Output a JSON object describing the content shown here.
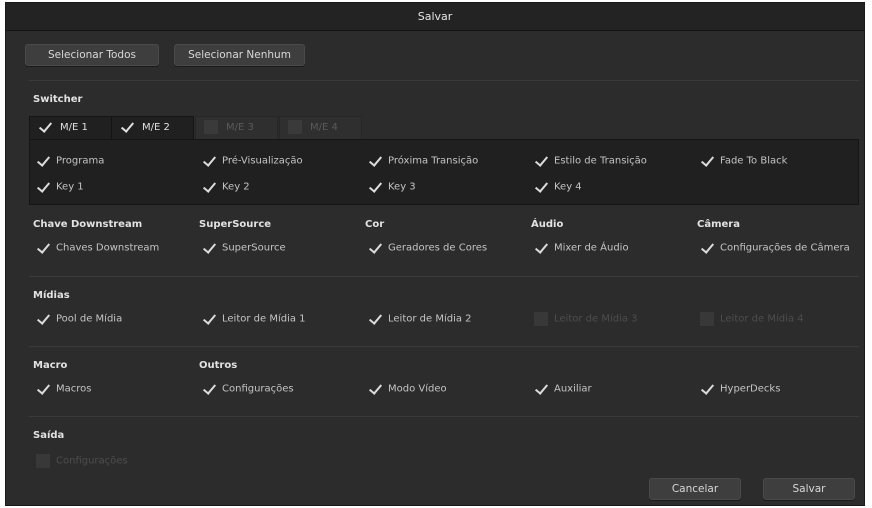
{
  "dialog": {
    "title": "Salvar"
  },
  "top_buttons": {
    "select_all": "Selecionar Todos",
    "select_none": "Selecionar Nenhum"
  },
  "switcher": {
    "title": "Switcher",
    "tabs": [
      {
        "label": "M/E 1",
        "checked": true,
        "active": true
      },
      {
        "label": "M/E 2",
        "checked": true,
        "active": true
      },
      {
        "label": "M/E 3",
        "checked": false,
        "active": false
      },
      {
        "label": "M/E 4",
        "checked": false,
        "active": false
      }
    ],
    "items": [
      {
        "label": "Programa",
        "checked": true
      },
      {
        "label": "Pré-Visualização",
        "checked": true
      },
      {
        "label": "Próxima Transição",
        "checked": true
      },
      {
        "label": "Estilo de Transição",
        "checked": true
      },
      {
        "label": "Fade To Black",
        "checked": true
      },
      {
        "label": "Key 1",
        "checked": true
      },
      {
        "label": "Key 2",
        "checked": true
      },
      {
        "label": "Key 3",
        "checked": true
      },
      {
        "label": "Key 4",
        "checked": true
      }
    ]
  },
  "groups_row": [
    {
      "title": "Chave Downstream",
      "item": "Chaves Downstream"
    },
    {
      "title": "SuperSource",
      "item": "SuperSource"
    },
    {
      "title": "Cor",
      "item": "Geradores de Cores"
    },
    {
      "title": "Áudio",
      "item": "Mixer de Áudio"
    },
    {
      "title": "Câmera",
      "item": "Configurações de Câmera"
    }
  ],
  "midias": {
    "title": "Mídias",
    "items": [
      {
        "label": "Pool de Mídia",
        "checked": true
      },
      {
        "label": "Leitor de Mídia 1",
        "checked": true
      },
      {
        "label": "Leitor de Mídia 2",
        "checked": true
      },
      {
        "label": "Leitor de Mídia 3",
        "checked": false
      },
      {
        "label": "Leitor de Mídia 4",
        "checked": false
      }
    ]
  },
  "macro": {
    "title": "Macro",
    "item": "Macros"
  },
  "outros": {
    "title": "Outros",
    "items": [
      {
        "label": "Configurações",
        "checked": true
      },
      {
        "label": "Modo Vídeo",
        "checked": true
      },
      {
        "label": "Auxiliar",
        "checked": true
      },
      {
        "label": "HyperDecks",
        "checked": true
      }
    ]
  },
  "saida": {
    "title": "Saída",
    "item": "Configurações",
    "checked": false
  },
  "footer": {
    "cancel": "Cancelar",
    "save": "Salvar"
  },
  "icons": {
    "check": "checkmark-icon",
    "empty": "empty-checkbox-icon"
  }
}
